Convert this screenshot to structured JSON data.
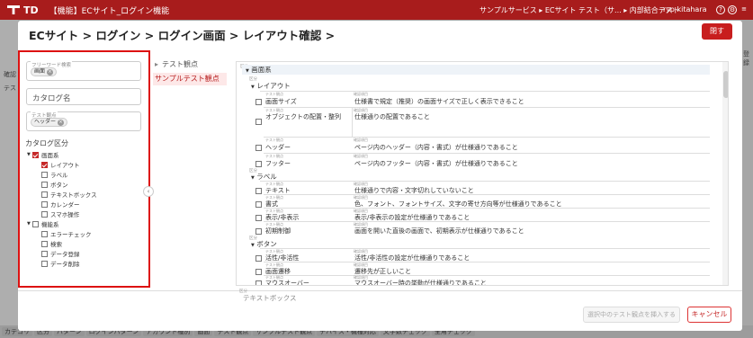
{
  "header": {
    "app_title": "【機能】ECサイト_ログイン機能",
    "breadcrumb": "サンプルサービス ▸ ECサイト テスト（サ... ▸ 内部結合テスト",
    "user_name": "ryo kitahara",
    "colors": {
      "header_bg": "#a81c1c",
      "accent": "#c81e1e"
    }
  },
  "background": {
    "left_labels": [
      "確認",
      "テス"
    ],
    "right_labels": [
      "登録"
    ],
    "bottom_tabs": [
      "カテゴリ",
      "区分",
      "パターン",
      "ログインパターン",
      "アカウント種別",
      "画面",
      "テスト観点",
      "サンプルテスト観点",
      "デバイス・機種対応",
      "文字数チェック",
      "全角チェック"
    ]
  },
  "modal": {
    "title": "ECサイト > ログイン > ログイン画面 > レイアウト確認 >",
    "close_label": "閉す",
    "filters": {
      "freeword_label": "フリーワード検索",
      "freeword_chip": "画面",
      "catalog_placeholder": "カタログ名",
      "viewpoint_label": "テスト観点",
      "viewpoint_chip": "ヘッダー",
      "category_title": "カタログ区分",
      "tree": [
        {
          "label": "画面系",
          "checked": true,
          "level": 0,
          "expanded": true
        },
        {
          "label": "レイアウト",
          "checked": true,
          "level": 1
        },
        {
          "label": "ラベル",
          "checked": false,
          "level": 1
        },
        {
          "label": "ボタン",
          "checked": false,
          "level": 1
        },
        {
          "label": "テキストボックス",
          "checked": false,
          "level": 1
        },
        {
          "label": "カレンダー",
          "checked": false,
          "level": 1
        },
        {
          "label": "スマホ操作",
          "checked": false,
          "level": 1
        },
        {
          "label": "機能系",
          "checked": false,
          "level": 0,
          "expanded": true
        },
        {
          "label": "エラーチェック",
          "checked": false,
          "level": 1
        },
        {
          "label": "検索",
          "checked": false,
          "level": 1
        },
        {
          "label": "データ登録",
          "checked": false,
          "level": 1
        },
        {
          "label": "データ削除",
          "checked": false,
          "level": 1
        }
      ]
    },
    "viewpoints": {
      "heading": "テスト観点",
      "selected": "サンプルテスト観点"
    },
    "tests": {
      "root": "画面系",
      "mini_group": "区分",
      "mini_name": "テスト観点",
      "mini_desc": "確認項目",
      "groups": [
        {
          "name": "レイアウト",
          "items": [
            {
              "name": "画面サイズ",
              "desc": "仕様書で規定（推奨）の画面サイズで正しく表示できること"
            },
            {
              "name": "オブジェクトの配置・整列",
              "desc": "仕様通りの配置であること"
            },
            {
              "name": "ヘッダー",
              "desc": "ページ内のヘッダー（内容・書式）が仕様通りであること"
            },
            {
              "name": "フッター",
              "desc": "ページ内のフッター（内容・書式）が仕様通りであること"
            }
          ]
        },
        {
          "name": "ラベル",
          "items": [
            {
              "name": "テキスト",
              "desc": "仕様通りで内容・文字切れしていないこと"
            },
            {
              "name": "書式",
              "desc": "色、フォント、フォントサイズ、文字の寄せ方向等が仕様通りであること"
            },
            {
              "name": "表示/非表示",
              "desc": "表示/非表示の設定が仕様通りであること"
            },
            {
              "name": "初期制御",
              "desc": "画面を開いた直後の画面で、初期表示が仕様通りであること"
            }
          ]
        },
        {
          "name": "ボタン",
          "items": [
            {
              "name": "活性/非活性",
              "desc": "活性/非活性の設定が仕様通りであること"
            },
            {
              "name": "画面遷移",
              "desc": "遷移先が正しいこと"
            },
            {
              "name": "マウスオーバー",
              "desc": "マウスオーバー時の挙動が仕様通りであること"
            }
          ]
        },
        {
          "name": "テキストボックス",
          "items": []
        }
      ]
    },
    "footer": {
      "insert_label": "選択中のテスト観点を挿入する",
      "cancel_label": "キャンセル"
    }
  }
}
